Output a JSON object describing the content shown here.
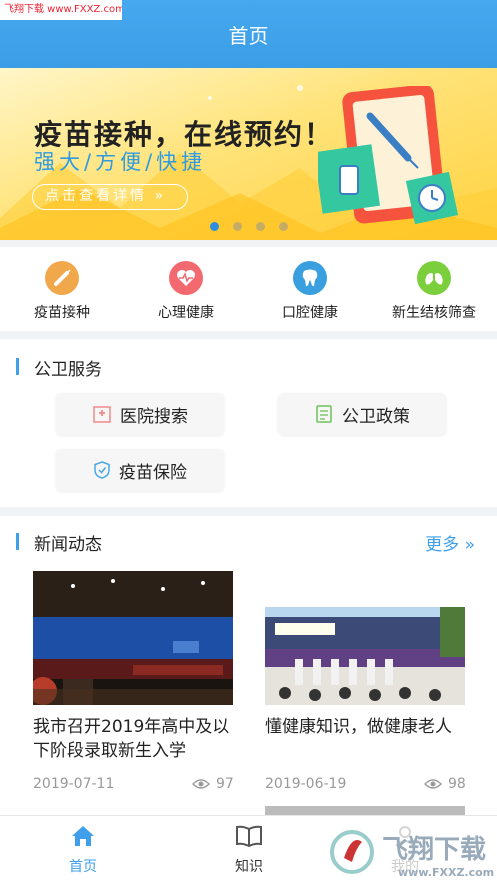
{
  "watermark": {
    "text": "飞翔下载 www.FXXZ.com"
  },
  "header": {
    "title": "首页"
  },
  "banner": {
    "title": "疫苗接种，在线预约！",
    "subtitle": "强大/方便/快捷",
    "button": "点击查看详情",
    "arrow": "»",
    "slide_count": 4,
    "active_slide": 1
  },
  "quick_entries": [
    {
      "label": "疫苗接种",
      "icon": "syringe-icon",
      "color": "#f0a84a"
    },
    {
      "label": "心理健康",
      "icon": "heartbeat-icon",
      "color": "#f26a70"
    },
    {
      "label": "口腔健康",
      "icon": "tooth-icon",
      "color": "#3a9fde"
    },
    {
      "label": "新生结核筛查",
      "icon": "lungs-icon",
      "color": "#7ccf3c"
    }
  ],
  "public_service": {
    "title": "公卫服务",
    "items": [
      {
        "label": "医院搜索",
        "icon": "hospital-icon"
      },
      {
        "label": "公卫政策",
        "icon": "document-icon"
      },
      {
        "label": "疫苗保险",
        "icon": "shield-icon"
      }
    ]
  },
  "news": {
    "title": "新闻动态",
    "more": "更多",
    "more_icon": "»",
    "items": [
      {
        "title": "我市召开2019年高中及以下阶段录取新生入学",
        "date": "2019-07-11",
        "views": "97"
      },
      {
        "title": "懂健康知识，做健康老人",
        "date": "2019-06-19",
        "views": "98"
      }
    ]
  },
  "tabbar": {
    "tabs": [
      {
        "label": "首页",
        "icon": "home-icon",
        "active": true
      },
      {
        "label": "知识",
        "icon": "book-icon",
        "active": false
      },
      {
        "label": "我的",
        "icon": "user-icon",
        "active": false
      }
    ]
  },
  "colors": {
    "primary": "#3f9fe8",
    "banner_bg": "#ffd23f"
  }
}
